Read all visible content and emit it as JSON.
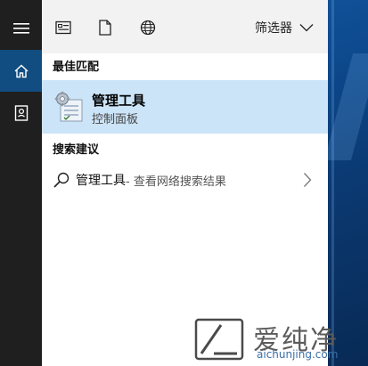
{
  "topbar": {
    "filter_label": "筛选器",
    "icons": [
      "document-list-icon",
      "blank-document-icon",
      "globe-icon",
      "chevron-down-icon"
    ]
  },
  "rail": {
    "icons": [
      "hamburger-menu-icon",
      "home-icon",
      "notebook-icon"
    ]
  },
  "best_match": {
    "section_title": "最佳匹配",
    "title": "管理工具",
    "subtitle": "控制面板"
  },
  "suggestions": {
    "section_title": "搜索建议",
    "items": [
      {
        "main": "管理工具",
        "rest": " - 查看网络搜索结果"
      }
    ]
  },
  "watermark": {
    "text": "爱纯净",
    "url": "aichunjing.com"
  },
  "colors": {
    "rail_bg": "#1f1f1f",
    "rail_active": "#114d80",
    "panel_bg": "#f2f2f2",
    "highlight": "#cce4f7"
  }
}
